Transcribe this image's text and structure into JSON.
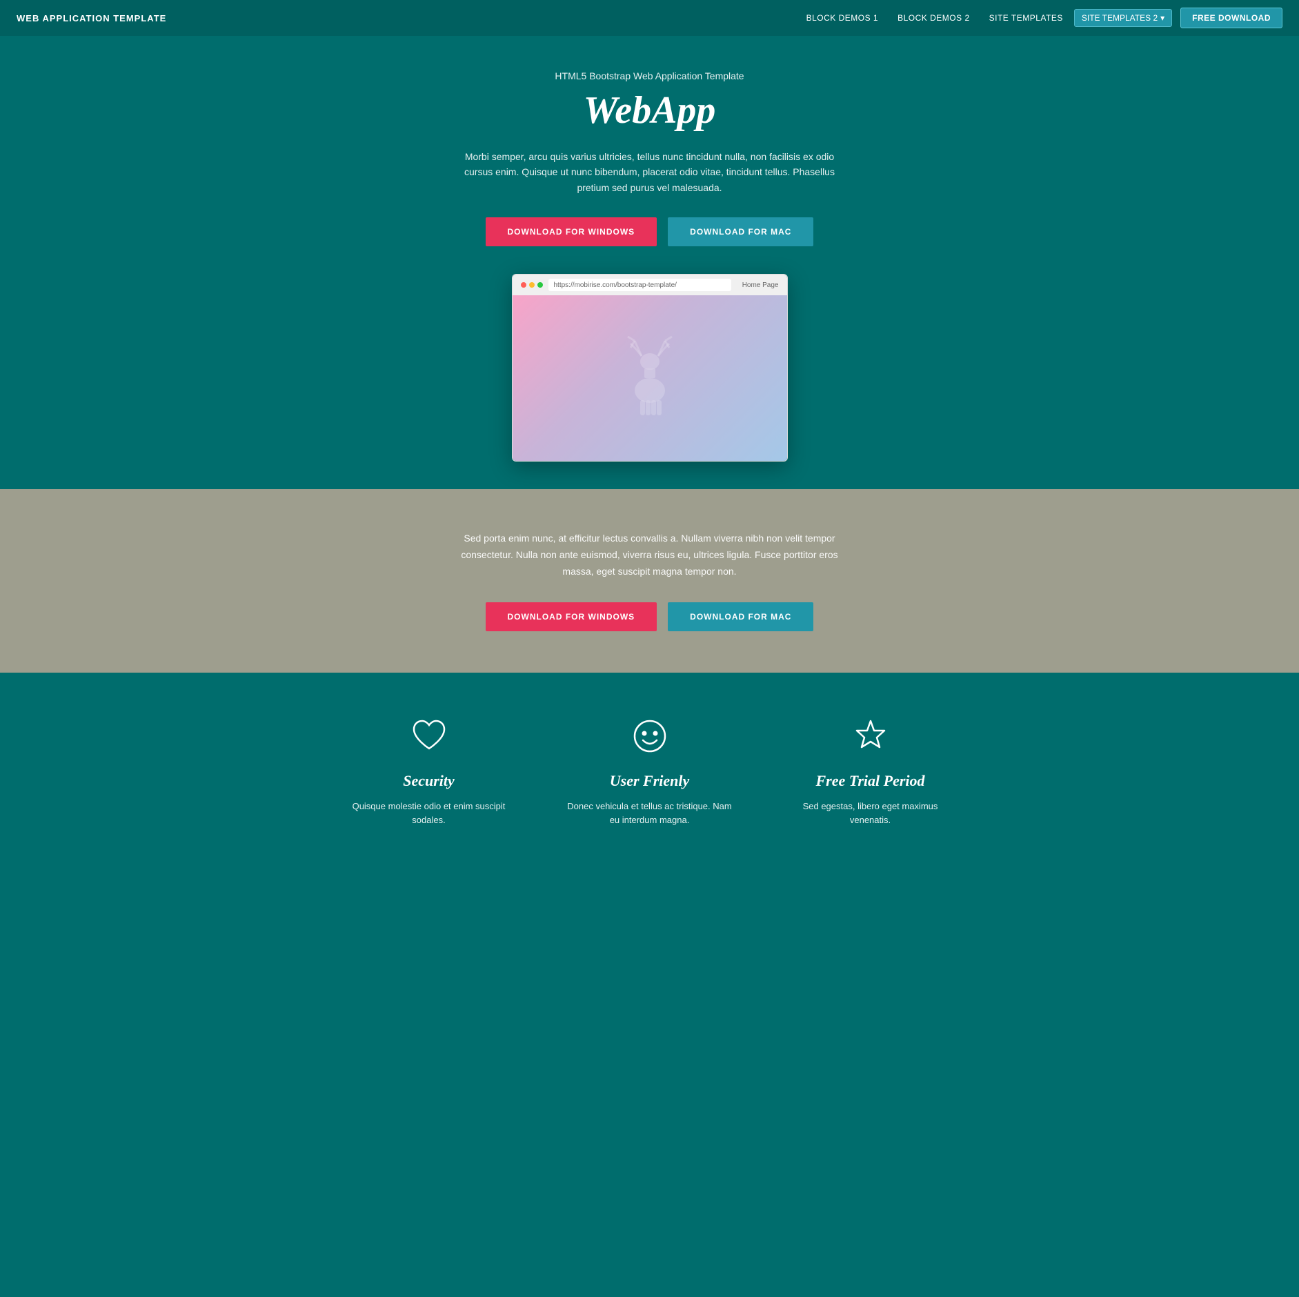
{
  "navbar": {
    "brand": "WEB APPLICATION TEMPLATE",
    "links": [
      {
        "label": "BLOCK DEMOS 1",
        "has_dropdown": true
      },
      {
        "label": "BLOCK DEMOS 2",
        "has_dropdown": true
      },
      {
        "label": "SITE TEMPLATES",
        "has_dropdown": true
      },
      {
        "label": "SITE TEMPLATES 2",
        "active": true,
        "has_dropdown": true
      }
    ],
    "cta_label": "FREE DOWNLOAD"
  },
  "hero": {
    "subtitle": "HTML5 Bootstrap Web Application Template",
    "title": "WebApp",
    "description": "Morbi semper, arcu quis varius ultricies, tellus nunc tincidunt nulla, non facilisis ex odio cursus enim. Quisque ut nunc bibendum, placerat odio vitae, tincidunt tellus. Phasellus pretium sed purus vel malesuada.",
    "btn_windows": "DOWNLOAD FOR WINDOWS",
    "btn_mac": "DOWNLOAD FOR MAC",
    "browser_url": "https://mobirise.com/bootstrap-template/",
    "browser_home": "Home Page"
  },
  "gray_section": {
    "text": "Sed porta enim nunc, at efficitur lectus convallis a. Nullam viverra nibh non velit tempor consectetur. Nulla non ante euismod, viverra risus eu, ultrices ligula. Fusce porttitor eros massa, eget suscipit magna tempor non.",
    "btn_windows": "DOWNLOAD FOR WINDOWS",
    "btn_mac": "DOWNLOAD FOR MAC"
  },
  "features": {
    "items": [
      {
        "icon": "heart",
        "title": "Security",
        "description": "Quisque molestie odio et enim suscipit sodales."
      },
      {
        "icon": "smiley",
        "title": "User Frienly",
        "description": "Donec vehicula et tellus ac tristique. Nam eu interdum magna."
      },
      {
        "icon": "star",
        "title": "Free Trial Period",
        "description": "Sed egestas, libero eget maximus venenatis."
      }
    ]
  }
}
